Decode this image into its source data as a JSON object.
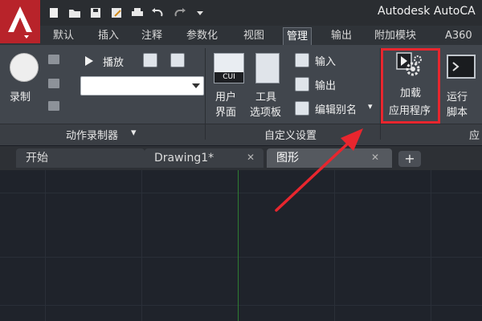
{
  "window": {
    "title": "Autodesk AutoCA"
  },
  "ribbon_tabs": [
    "默认",
    "插入",
    "注释",
    "参数化",
    "视图",
    "管理",
    "输出",
    "附加模块",
    "A360"
  ],
  "active_ribbon_tab": "管理",
  "panels": {
    "action_recorder": {
      "record_label": "录制",
      "play_label": "播放",
      "footer_label": "动作录制器",
      "dropdown_value": ""
    },
    "customization": {
      "cui_badge": "CUI",
      "ui_label_1": "用户",
      "ui_label_2": "界面",
      "palette_label_1": "工具",
      "palette_label_2": "选项板",
      "import_label": "输入",
      "export_label": "输出",
      "alias_label": "编辑别名",
      "footer_label": "自定义设置"
    },
    "applications": {
      "load_label_1": "加载",
      "load_label_2": "应用程序",
      "run_label_1": "运行",
      "run_label_2": "脚本",
      "footer_label": "应"
    }
  },
  "document_tabs": [
    {
      "label": "开始",
      "closable": false
    },
    {
      "label": "Drawing1*",
      "closable": true
    },
    {
      "label": "图形",
      "closable": true
    }
  ],
  "active_document_tab": "图形",
  "colors": {
    "highlight": "#e8262e",
    "app_button": "#b8232a",
    "canvas": "#1f232b",
    "y_axis": "#2e7d32"
  }
}
